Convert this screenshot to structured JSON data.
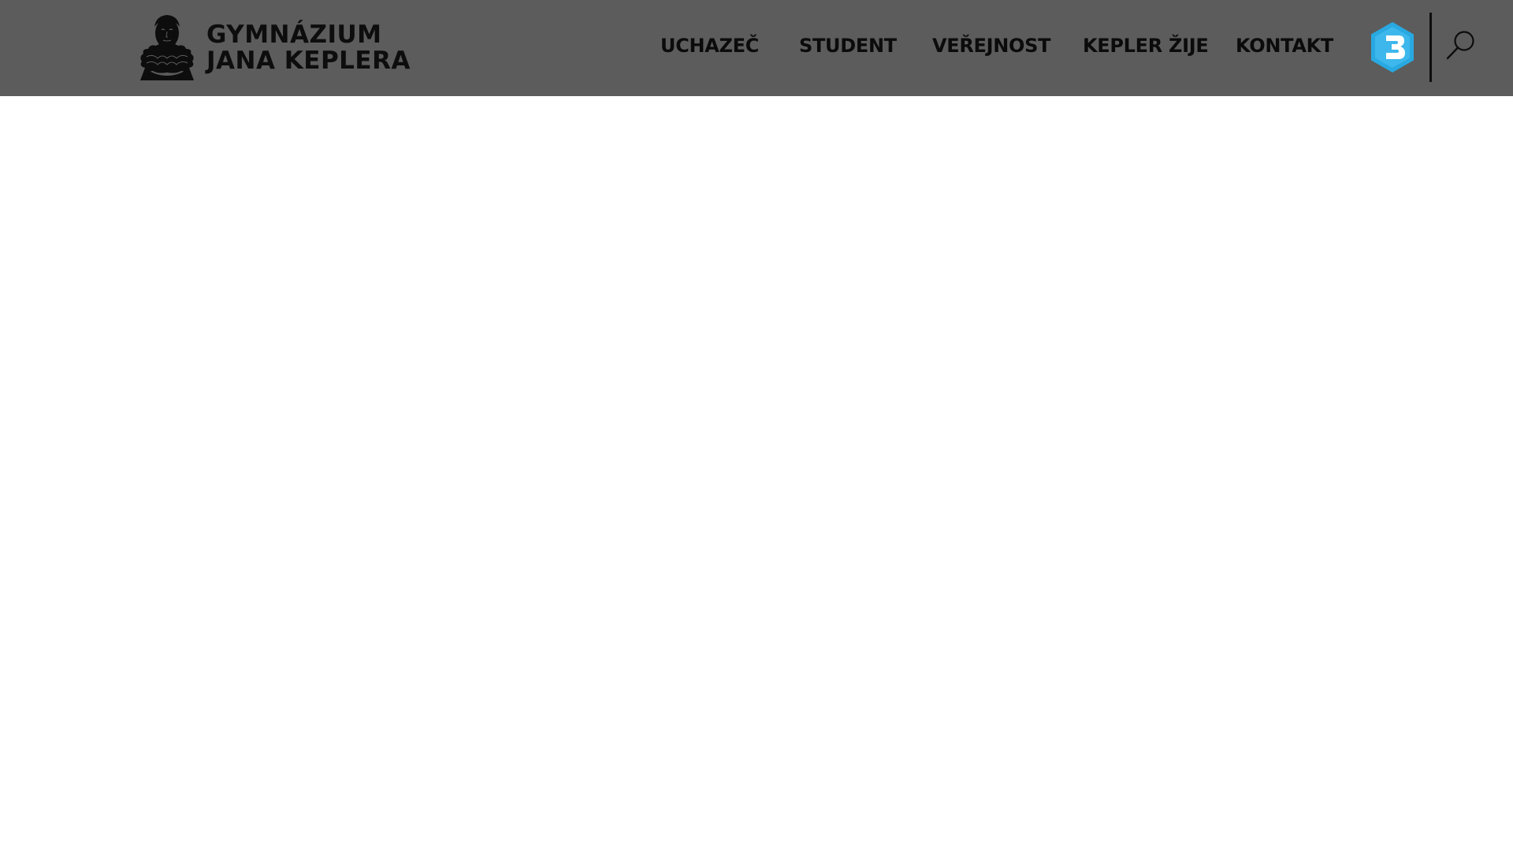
{
  "header": {
    "logo": {
      "line1": "GYMNÁZIUM",
      "line2": "JANA KEPLERA"
    },
    "nav": [
      {
        "label": "UCHAZEČ"
      },
      {
        "label": "STUDENT"
      },
      {
        "label": "VEŘEJNOST"
      },
      {
        "label": "KEPLER ŽIJE"
      },
      {
        "label": "KONTAKT"
      }
    ],
    "app_icon": "bakalari-app-icon",
    "search_icon": "search-icon"
  },
  "colors": {
    "header_bg": "#5c5c5c",
    "text": "#0b0b0b",
    "accent": "#29a9e1",
    "page_bg": "#ffffff"
  }
}
